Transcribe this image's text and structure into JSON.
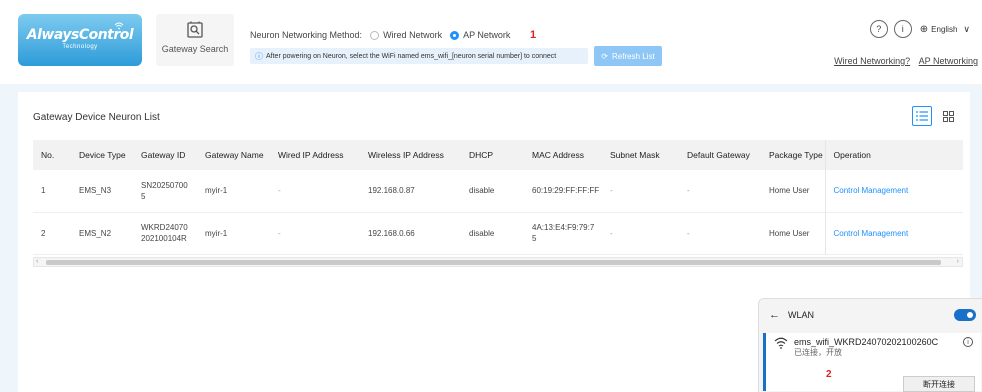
{
  "header": {
    "logo_text": "AlwaysControl",
    "logo_sub": "Technology",
    "gateway_search_label": "Gateway Search",
    "method_label": "Neuron Networking Method:",
    "options": [
      "Wired Network",
      "AP Network"
    ],
    "selected_option": "AP Network",
    "marker": "1",
    "info_text": "After powering on Neuron, select the WiFi named ems_wifi_[neuron serial number] to connect",
    "refresh_label": "Refresh List",
    "language": "English",
    "link_wired": "Wired Networking?",
    "link_ap": "AP Networking"
  },
  "list": {
    "title": "Gateway Device Neuron List",
    "columns": [
      "No.",
      "Device Type",
      "Gateway ID",
      "Gateway Name",
      "Wired IP Address",
      "Wireless IP Address",
      "DHCP",
      "MAC Address",
      "Subnet Mask",
      "Default Gateway",
      "Package Type",
      "Operation"
    ],
    "rows": [
      [
        "1",
        "EMS_N3",
        "SN20250700\n5",
        "myir-1",
        "-",
        "192.168.0.87",
        "disable",
        "60:19:29:FF:FF:FF",
        "-",
        "-",
        "Home User",
        "Control Management"
      ],
      [
        "2",
        "EMS_N2",
        "WKRD24070\n202100104R",
        "myir-1",
        "-",
        "192.168.0.66",
        "disable",
        "4A:13:E4:F9:79:7\n5",
        "-",
        "-",
        "Home User",
        "Control Management"
      ]
    ]
  },
  "wlan": {
    "title": "WLAN",
    "toggle_on": true,
    "ssid": "ems_wifi_WKRD24070202100260C",
    "status": "已连接，开放",
    "marker": "2",
    "disconnect_label": "断开连接"
  },
  "colors": {
    "accent": "#1e90ff",
    "marker": "#e02020"
  }
}
